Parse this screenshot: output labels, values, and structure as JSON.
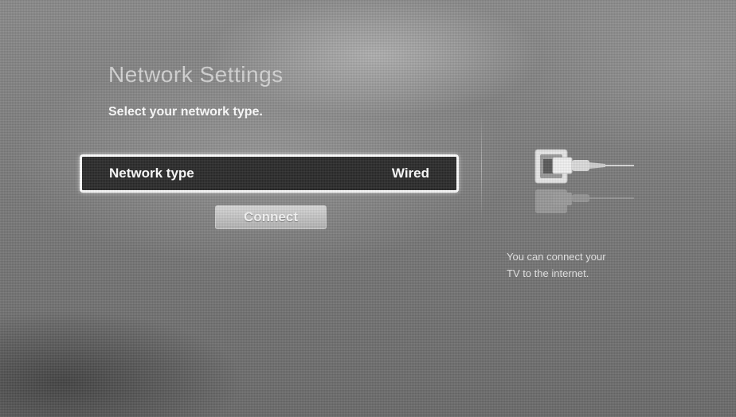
{
  "screen": {
    "title": "Network Settings",
    "subtitle": "Select your network type.",
    "setting": {
      "label": "Network type",
      "value": "Wired"
    },
    "connect_label": "Connect"
  },
  "side_panel": {
    "icon": "lan-cable-icon",
    "help_line_1": "You can connect your",
    "help_line_2": "TV to the internet."
  }
}
